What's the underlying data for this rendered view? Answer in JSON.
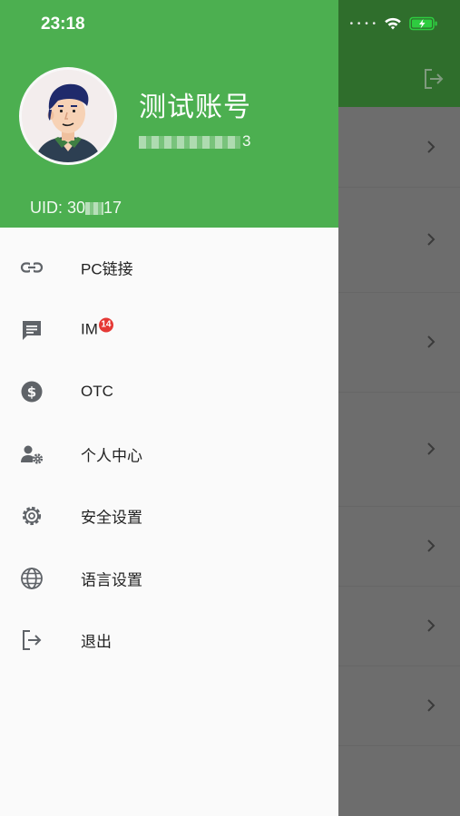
{
  "status_bar": {
    "time": "23:18",
    "signal_icon": "cellular-dots-icon",
    "wifi_icon": "wifi-icon",
    "battery_icon": "battery-charging-icon",
    "battery_color": "#2ecc40"
  },
  "drawer": {
    "header_color": "#4caf50",
    "avatar_icon": "user-avatar",
    "account_name": "测试账号",
    "phone_suffix": "3",
    "uid_prefix": "UID: 30",
    "uid_suffix": "17",
    "menu": [
      {
        "icon": "link-icon",
        "label": "PC链接"
      },
      {
        "icon": "chat-icon",
        "label": "IM",
        "badge": "14"
      },
      {
        "icon": "dollar-circle-icon",
        "label": "OTC"
      },
      {
        "icon": "user-settings-icon",
        "label": "个人中心"
      },
      {
        "icon": "gear-icon",
        "label": "安全设置"
      },
      {
        "icon": "globe-icon",
        "label": "语言设置"
      },
      {
        "icon": "logout-icon",
        "label": "退出"
      }
    ]
  },
  "background_app": {
    "header_color": "#2f6e2c",
    "header_icon": "logout-icon",
    "row_icon": "chevron-right-icon"
  }
}
